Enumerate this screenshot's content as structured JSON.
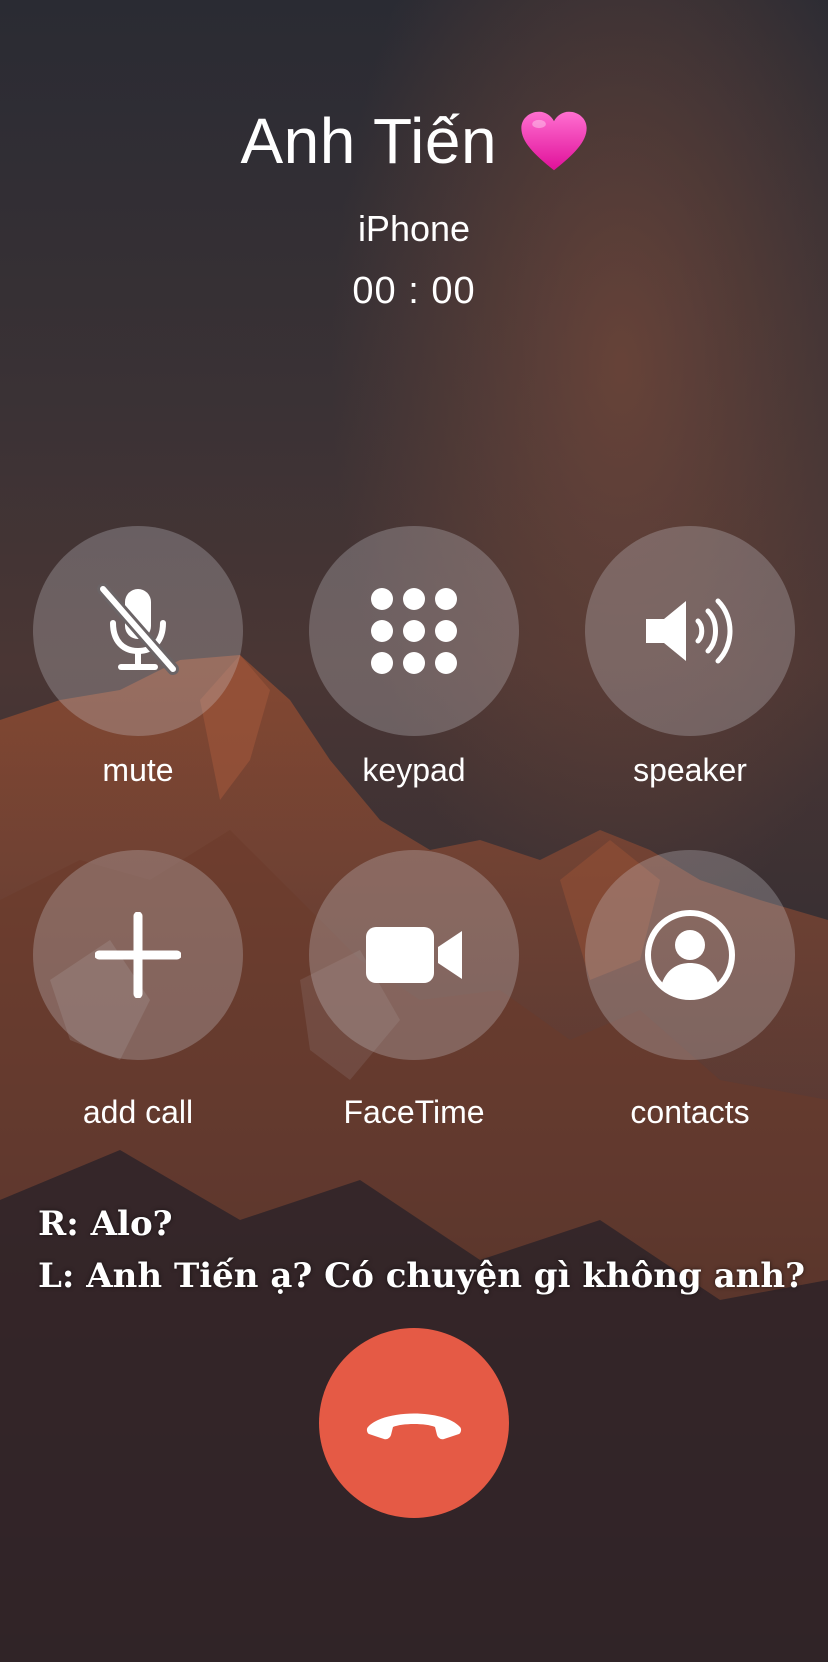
{
  "call": {
    "contact_name": "Anh Tiến",
    "name_emoji_icon": "pink-heart-icon",
    "source": "iPhone",
    "timer": "00 : 00"
  },
  "buttons": [
    {
      "label": "mute",
      "icon": "microphone-off-icon"
    },
    {
      "label": "keypad",
      "icon": "keypad-dots-icon"
    },
    {
      "label": "speaker",
      "icon": "speaker-icon"
    },
    {
      "label": "add call",
      "icon": "plus-icon"
    },
    {
      "label": "FaceTime",
      "icon": "video-camera-icon"
    },
    {
      "label": "contacts",
      "icon": "contact-person-icon"
    }
  ],
  "transcript": [
    "R: Alo?",
    "L: Anh Tiến ạ? Có chuyện gì không anh?"
  ],
  "end_call": {
    "icon": "phone-hangup-icon",
    "color": "#e55a45"
  },
  "colors": {
    "button_background": "rgba(210,210,215,0.28)",
    "text": "#ffffff"
  }
}
